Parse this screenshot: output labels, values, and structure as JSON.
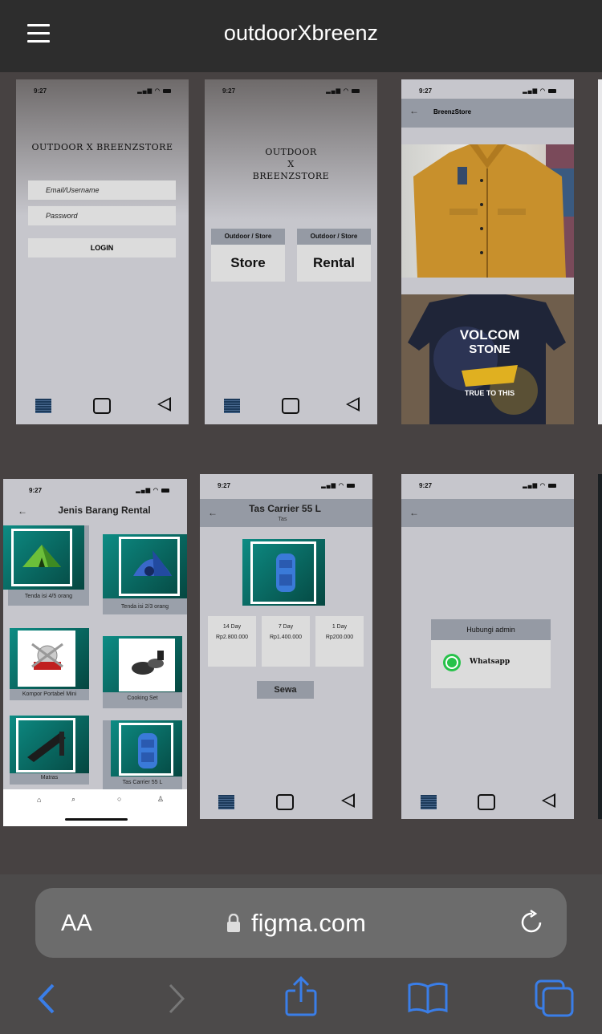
{
  "header": {
    "title": "outdoorXbreenz",
    "menu_icon": "hamburger-icon"
  },
  "status_time": "9:27",
  "frame_login": {
    "logo": "OUTDOOR X BREENZSTORE",
    "email_placeholder": "Email/Username",
    "password_placeholder": "Password",
    "login_label": "LOGIN"
  },
  "frame_menu": {
    "logo_line1": "OUTDOOR",
    "logo_line2": "X",
    "logo_line3": "BREENZSTORE",
    "cards": [
      {
        "header": "Outdoor / Store",
        "label": "Store"
      },
      {
        "header": "Outdoor / Store",
        "label": "Rental"
      }
    ]
  },
  "frame_store": {
    "title": "BreenzStore",
    "tshirt_text1": "VOLCOM",
    "tshirt_text2": "STONE",
    "tshirt_text3": "TRUE TO THIS"
  },
  "frame_rental": {
    "title": "Jenis Barang Rental",
    "items": [
      {
        "label": "Tenda isi 4/5 orang",
        "icon": "tent-green-icon"
      },
      {
        "label": "Tenda isi 2/3 orang",
        "icon": "tent-blue-icon"
      },
      {
        "label": "Kompor Portabel Mini",
        "icon": "stove-icon"
      },
      {
        "label": "Cooking Set",
        "icon": "cooking-set-icon"
      },
      {
        "label": "Matras",
        "icon": "mattress-icon"
      },
      {
        "label": "Tas Carrier 55 L",
        "icon": "backpack-icon"
      }
    ],
    "bottom_nav": [
      "home-icon",
      "search-icon",
      "chat-icon",
      "profile-icon"
    ]
  },
  "frame_detail": {
    "title": "Tas Carrier 55 L",
    "subtitle": "Tas",
    "prices": [
      {
        "duration": "14 Day",
        "price": "Rp2.800.000"
      },
      {
        "duration": "7 Day",
        "price": "Rp1.400.000"
      },
      {
        "duration": "1 Day",
        "price": "Rp200.000"
      }
    ],
    "rent_label": "Sewa"
  },
  "frame_contact": {
    "header": "Hubungi admin",
    "whatsapp_label": "Whatsapp"
  },
  "safari": {
    "text_size_label": "AA",
    "url": "figma.com",
    "icons": [
      "lock-icon",
      "reload-icon",
      "back-icon",
      "forward-icon",
      "share-icon",
      "bookmarks-icon",
      "tabs-icon"
    ]
  },
  "colors": {
    "canvas": "#474242",
    "frame": "#c6c6cc",
    "appbar": "#959aa4",
    "teal": "#0d8c84",
    "accent": "#3a7ee8"
  }
}
